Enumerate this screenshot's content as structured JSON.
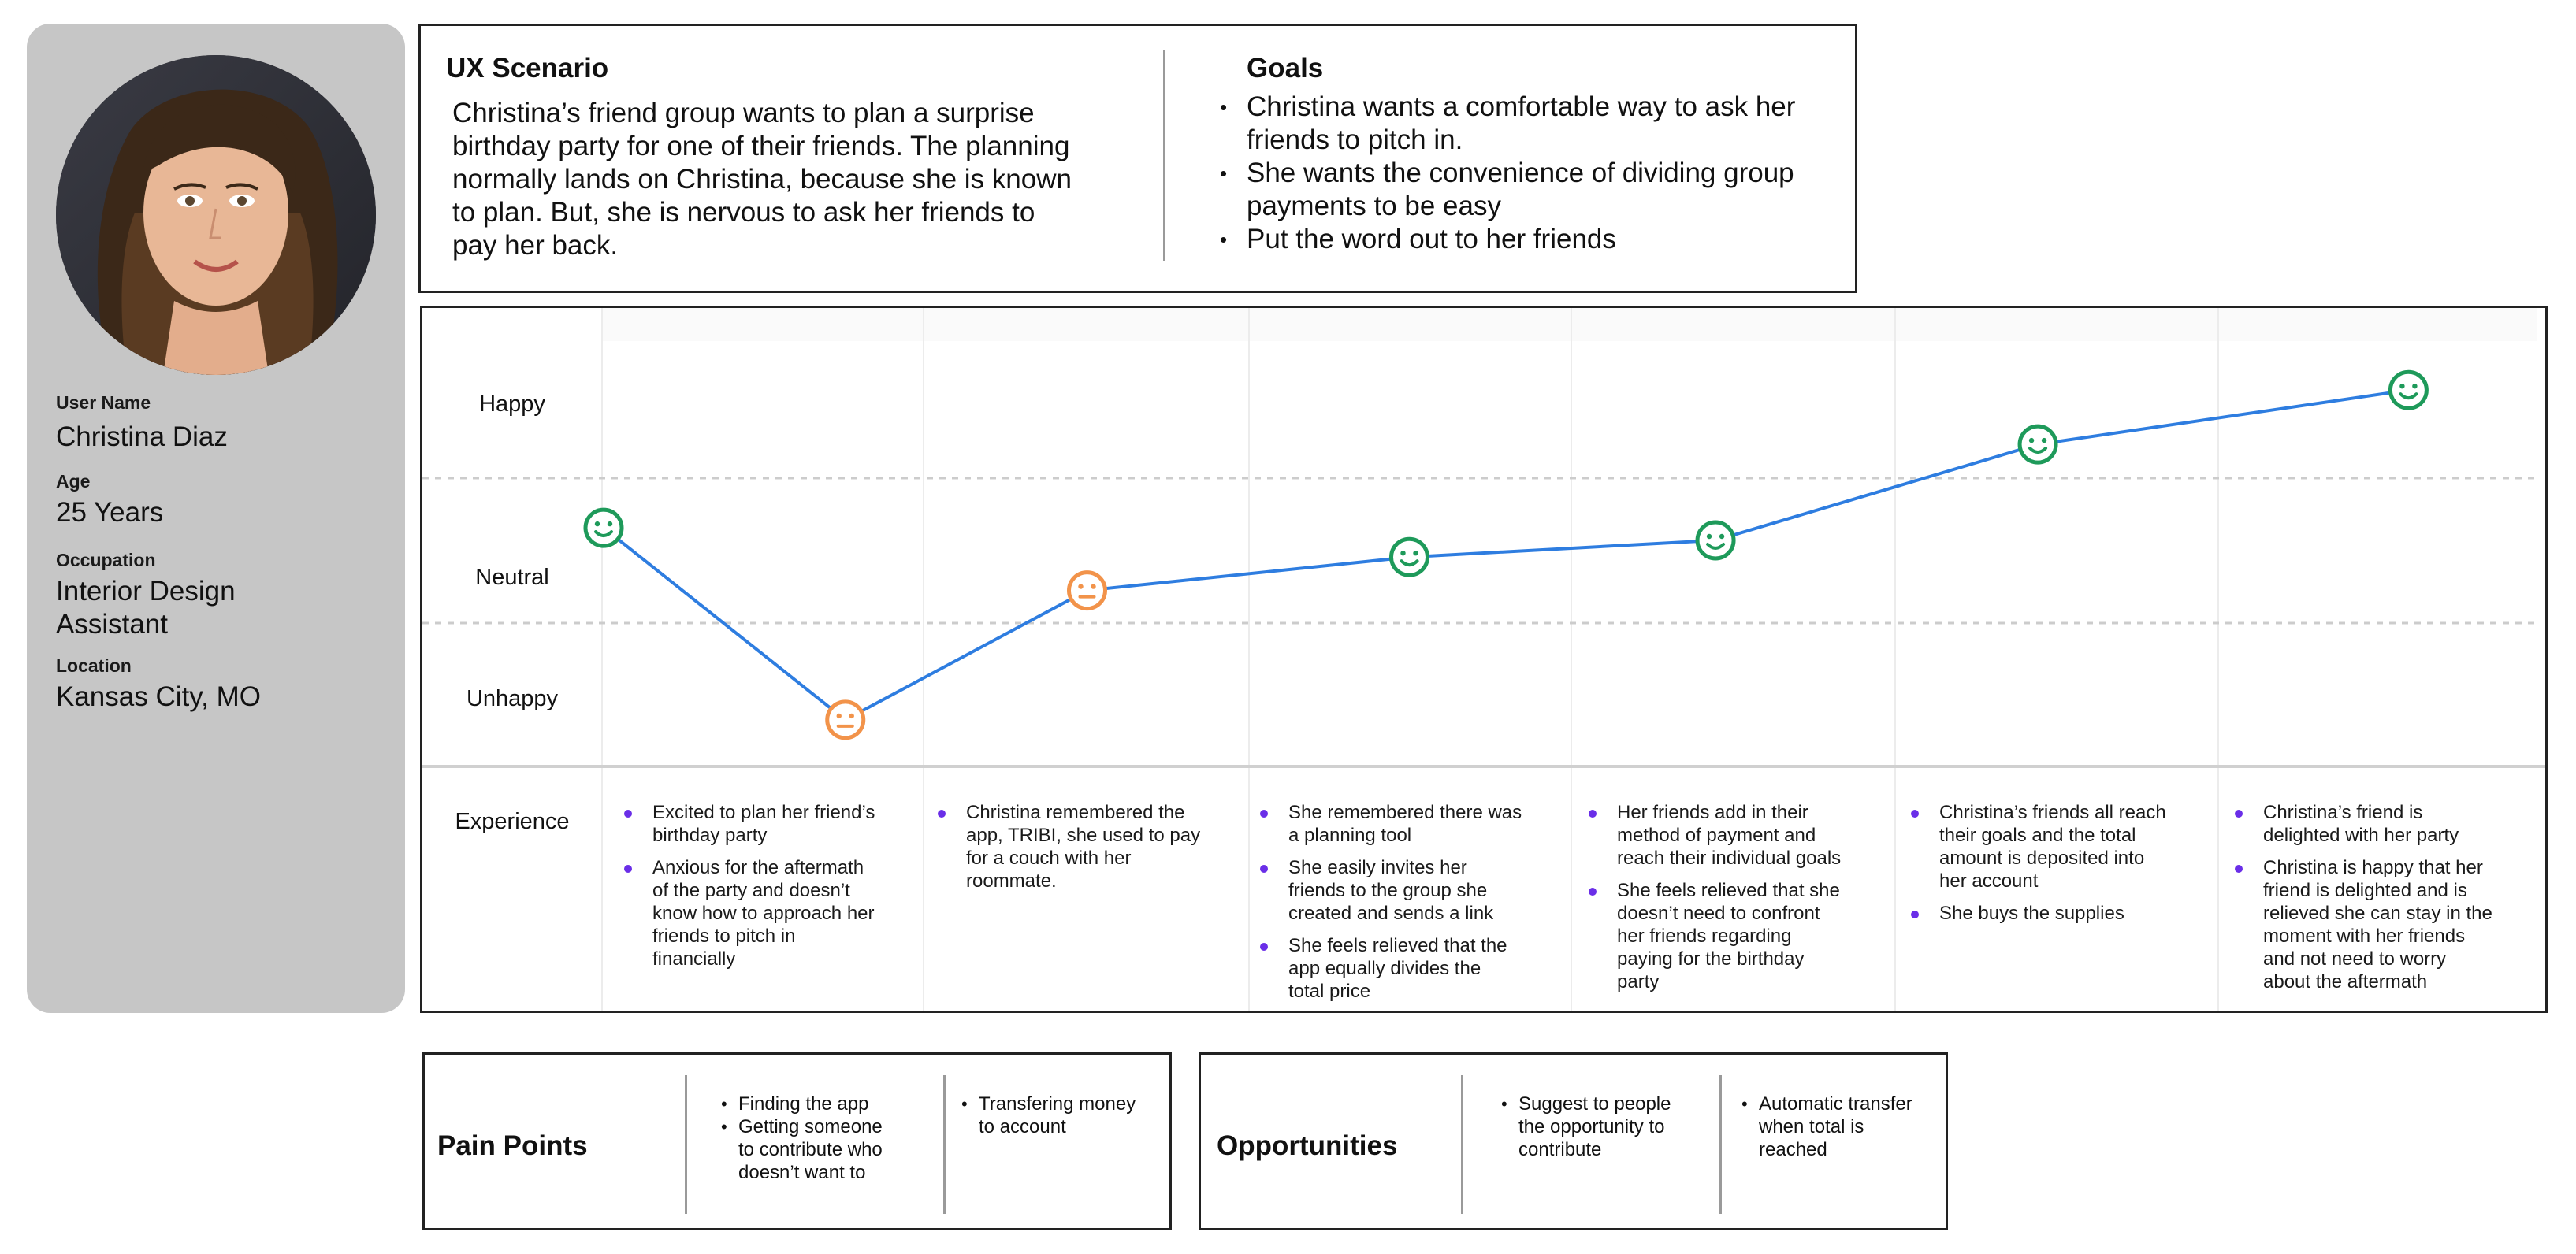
{
  "persona": {
    "name_label": "User Name",
    "name": "Christina Diaz",
    "age_label": "Age",
    "age": "25 Years",
    "occupation_label": "Occupation",
    "occupation_line1": "Interior Design",
    "occupation_line2": "Assistant",
    "location_label": "Location",
    "location": "Kansas City, MO"
  },
  "scenario": {
    "title": "UX Scenario",
    "lines": [
      "Christina’s friend group wants to plan a surprise",
      "birthday party for one of their friends. The planning",
      "normally lands on Christina, because she is known",
      "to plan. But, she is nervous to ask her friends to",
      "pay her back."
    ]
  },
  "goals": {
    "title": "Goals",
    "items": [
      [
        "Christina wants a comfortable way to ask her",
        "friends to pitch in."
      ],
      [
        "She wants the convenience of dividing group",
        "payments to be easy"
      ],
      [
        "Put the word out to her friends"
      ]
    ]
  },
  "journey": {
    "row_labels": {
      "happy": "Happy",
      "neutral": "Neutral",
      "unhappy": "Unhappy",
      "experience": "Experience"
    },
    "colors": {
      "line": "#2e7de0",
      "happy": "#1e9a5a",
      "neutral": "#f2934a",
      "bullet": "#6a2ee8"
    }
  },
  "chart_data": {
    "type": "line",
    "y_levels": [
      "Unhappy",
      "Neutral",
      "Happy"
    ],
    "points": [
      {
        "stage": 1,
        "mood": "happy",
        "emotion_score": 0.53
      },
      {
        "stage": 1.75,
        "mood": "neutral",
        "emotion_score": 0.07
      },
      {
        "stage": 2.5,
        "mood": "neutral",
        "emotion_score": 0.38
      },
      {
        "stage": 3.5,
        "mood": "happy",
        "emotion_score": 0.46
      },
      {
        "stage": 4.45,
        "mood": "happy",
        "emotion_score": 0.5
      },
      {
        "stage": 5.45,
        "mood": "happy",
        "emotion_score": 0.73
      },
      {
        "stage": 6.6,
        "mood": "happy",
        "emotion_score": 0.86
      }
    ]
  },
  "experience": [
    [
      [
        "Excited to plan her friend’s",
        "birthday party"
      ],
      [
        "Anxious for the aftermath",
        "of the party and doesn’t",
        "know how to approach her",
        "friends to pitch in",
        "financially"
      ]
    ],
    [
      [
        "Christina remembered the",
        "app, TRIBI, she used to pay",
        "for a couch with her",
        "roommate."
      ]
    ],
    [
      [
        "She remembered there was",
        "a planning tool"
      ],
      [
        "She easily invites her",
        "friends to the group she",
        "created and sends a link"
      ],
      [
        "She feels relieved that the",
        "app equally divides the",
        "total price"
      ]
    ],
    [
      [
        "Her friends add in their",
        "method of payment and",
        "reach their individual goals"
      ],
      [
        "She feels relieved that she",
        "doesn’t need to confront",
        "her friends regarding",
        "paying for the birthday",
        "party"
      ]
    ],
    [
      [
        "Christina’s friends all reach",
        "their goals and the total",
        "amount is deposited into",
        "her account"
      ],
      [
        "She buys the supplies"
      ]
    ],
    [
      [
        "Christina’s friend is",
        "delighted with her party"
      ],
      [
        "Christina is happy that her",
        "friend is delighted and is",
        "relieved she can stay in the",
        "moment with her friends",
        "and not need to worry",
        "about the aftermath"
      ]
    ]
  ],
  "pain_points": {
    "title": "Pain Points",
    "col1": [
      [
        "Finding the app"
      ],
      [
        "Getting someone",
        "to contribute who",
        "doesn’t want to"
      ]
    ],
    "col2": [
      [
        "Transfering money",
        "to account"
      ]
    ]
  },
  "opportunities": {
    "title": "Opportunities",
    "col1": [
      [
        "Suggest to people",
        "the opportunity to",
        "contribute"
      ]
    ],
    "col2": [
      [
        "Automatic transfer",
        "when total is",
        "reached"
      ]
    ]
  }
}
